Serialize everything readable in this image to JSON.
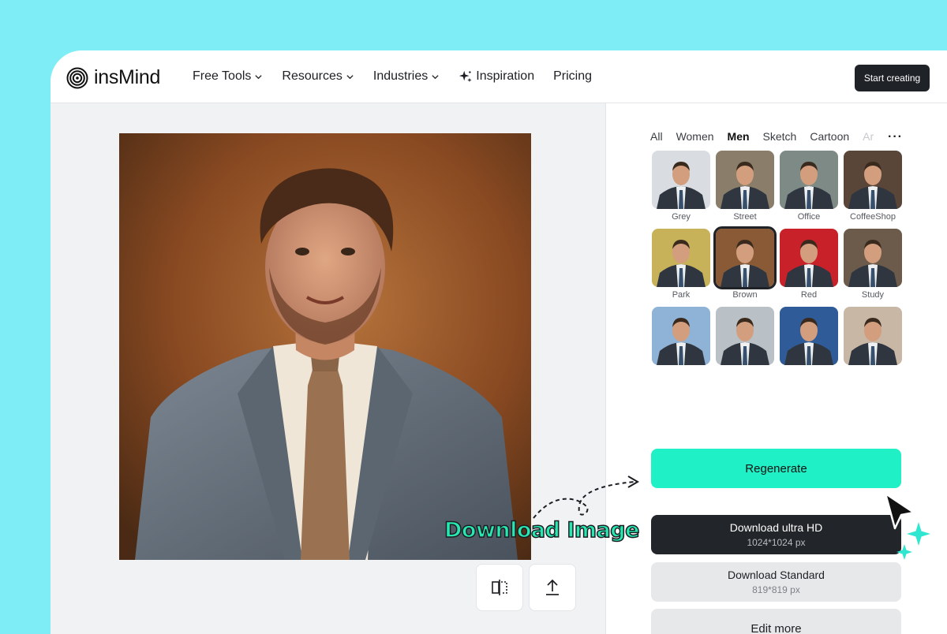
{
  "brand": {
    "name": "insMind"
  },
  "nav": {
    "items": [
      {
        "label": "Free Tools",
        "dropdown": true
      },
      {
        "label": "Resources",
        "dropdown": true
      },
      {
        "label": "Industries",
        "dropdown": true
      },
      {
        "label": "Inspiration",
        "icon": "sparkle-icon"
      },
      {
        "label": "Pricing"
      }
    ],
    "cta_label": "Start creating"
  },
  "panel": {
    "tabs": [
      "All",
      "Women",
      "Men",
      "Sketch",
      "Cartoon",
      "Ar"
    ],
    "active_tab": "Men",
    "more_label": "···",
    "styles": [
      {
        "label": "Grey",
        "bg": "#d9dde2"
      },
      {
        "label": "Street",
        "bg": "#8a7d6a"
      },
      {
        "label": "Office",
        "bg": "#7d8a86"
      },
      {
        "label": "CoffeeShop",
        "bg": "#5a4638"
      },
      {
        "label": "Park",
        "bg": "#c7b25a"
      },
      {
        "label": "Brown",
        "bg": "#8a5a36",
        "selected": true
      },
      {
        "label": "Red",
        "bg": "#c8212a"
      },
      {
        "label": "Study",
        "bg": "#6c5b4a"
      },
      {
        "label": "",
        "bg": "#8fb3d6"
      },
      {
        "label": "",
        "bg": "#b9c0c6"
      },
      {
        "label": "",
        "bg": "#2f5c98"
      },
      {
        "label": "",
        "bg": "#c9b7a6"
      }
    ],
    "regenerate_label": "Regenerate",
    "download_hd": {
      "label": "Download ultra HD",
      "size": "1024*1024 px"
    },
    "download_std": {
      "label": "Download Standard",
      "size": "819*819 px"
    },
    "edit_more_label": "Edit more"
  },
  "annotation": {
    "text": "Download Image"
  },
  "colors": {
    "background": "#7EEDF5",
    "accent": "#1FF0C6",
    "dark": "#22252a"
  }
}
